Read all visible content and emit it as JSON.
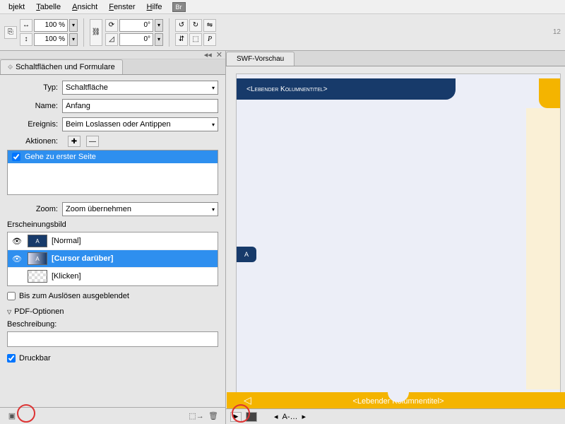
{
  "menu": {
    "objekt": "bjekt",
    "tabelle": "Tabelle",
    "ansicht": "Ansicht",
    "fenster": "Fenster",
    "hilfe": "Hilfe",
    "br": "Br"
  },
  "toolbar": {
    "zoom1": "100 %",
    "zoom2": "100 %",
    "angle1": "0°",
    "angle2": "0°",
    "pageNum": "12"
  },
  "panel": {
    "tab": "Schaltflächen und Formulare",
    "labels": {
      "typ": "Typ:",
      "name": "Name:",
      "ereignis": "Ereignis:",
      "aktionen": "Aktionen:",
      "zoom": "Zoom:",
      "erscheinungsbild": "Erscheinungsbild",
      "beschreibung": "Beschreibung:"
    },
    "values": {
      "typ": "Schaltfläche",
      "name": "Anfang",
      "ereignis": "Beim Loslassen oder Antippen",
      "zoom": "Zoom übernehmen"
    },
    "actionItem": "Gehe zu erster Seite",
    "states": {
      "normal": "[Normal]",
      "hover": "[Cursor darüber]",
      "click": "[Klicken]"
    },
    "chkHidden": "Bis zum Auslösen ausgeblendet",
    "pdfOpts": "PDF-Optionen",
    "chkDruckbar": "Druckbar"
  },
  "preview": {
    "tab": "SWF-Vorschau",
    "topBanner": "<Lebender Kolumnentitel>",
    "midTab": "A",
    "bottomBanner": "<Lebender Kolumnentitel>",
    "pageIndicator": "A-…"
  }
}
